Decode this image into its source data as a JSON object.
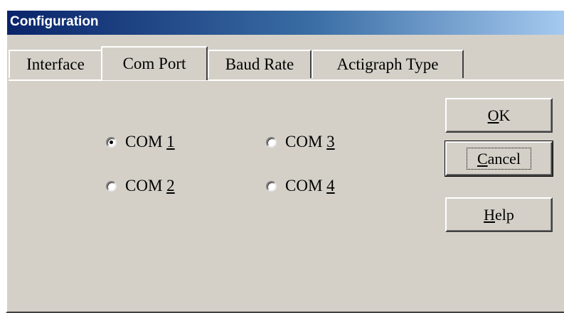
{
  "window": {
    "title": "Configuration"
  },
  "tabs": [
    {
      "label": "Interface",
      "active": false
    },
    {
      "label": "Com Port",
      "active": true
    },
    {
      "label": "Baud Rate",
      "active": false
    },
    {
      "label": "Actigraph Type",
      "active": false
    }
  ],
  "com_ports": [
    {
      "prefix": "COM ",
      "accel": "1",
      "checked": true
    },
    {
      "prefix": "COM ",
      "accel": "2",
      "checked": false
    },
    {
      "prefix": "COM ",
      "accel": "3",
      "checked": false
    },
    {
      "prefix": "COM ",
      "accel": "4",
      "checked": false
    }
  ],
  "buttons": {
    "ok": {
      "accel": "O",
      "rest": "K"
    },
    "cancel": {
      "accel": "C",
      "rest": "ancel"
    },
    "help": {
      "accel": "H",
      "rest": "elp"
    }
  }
}
